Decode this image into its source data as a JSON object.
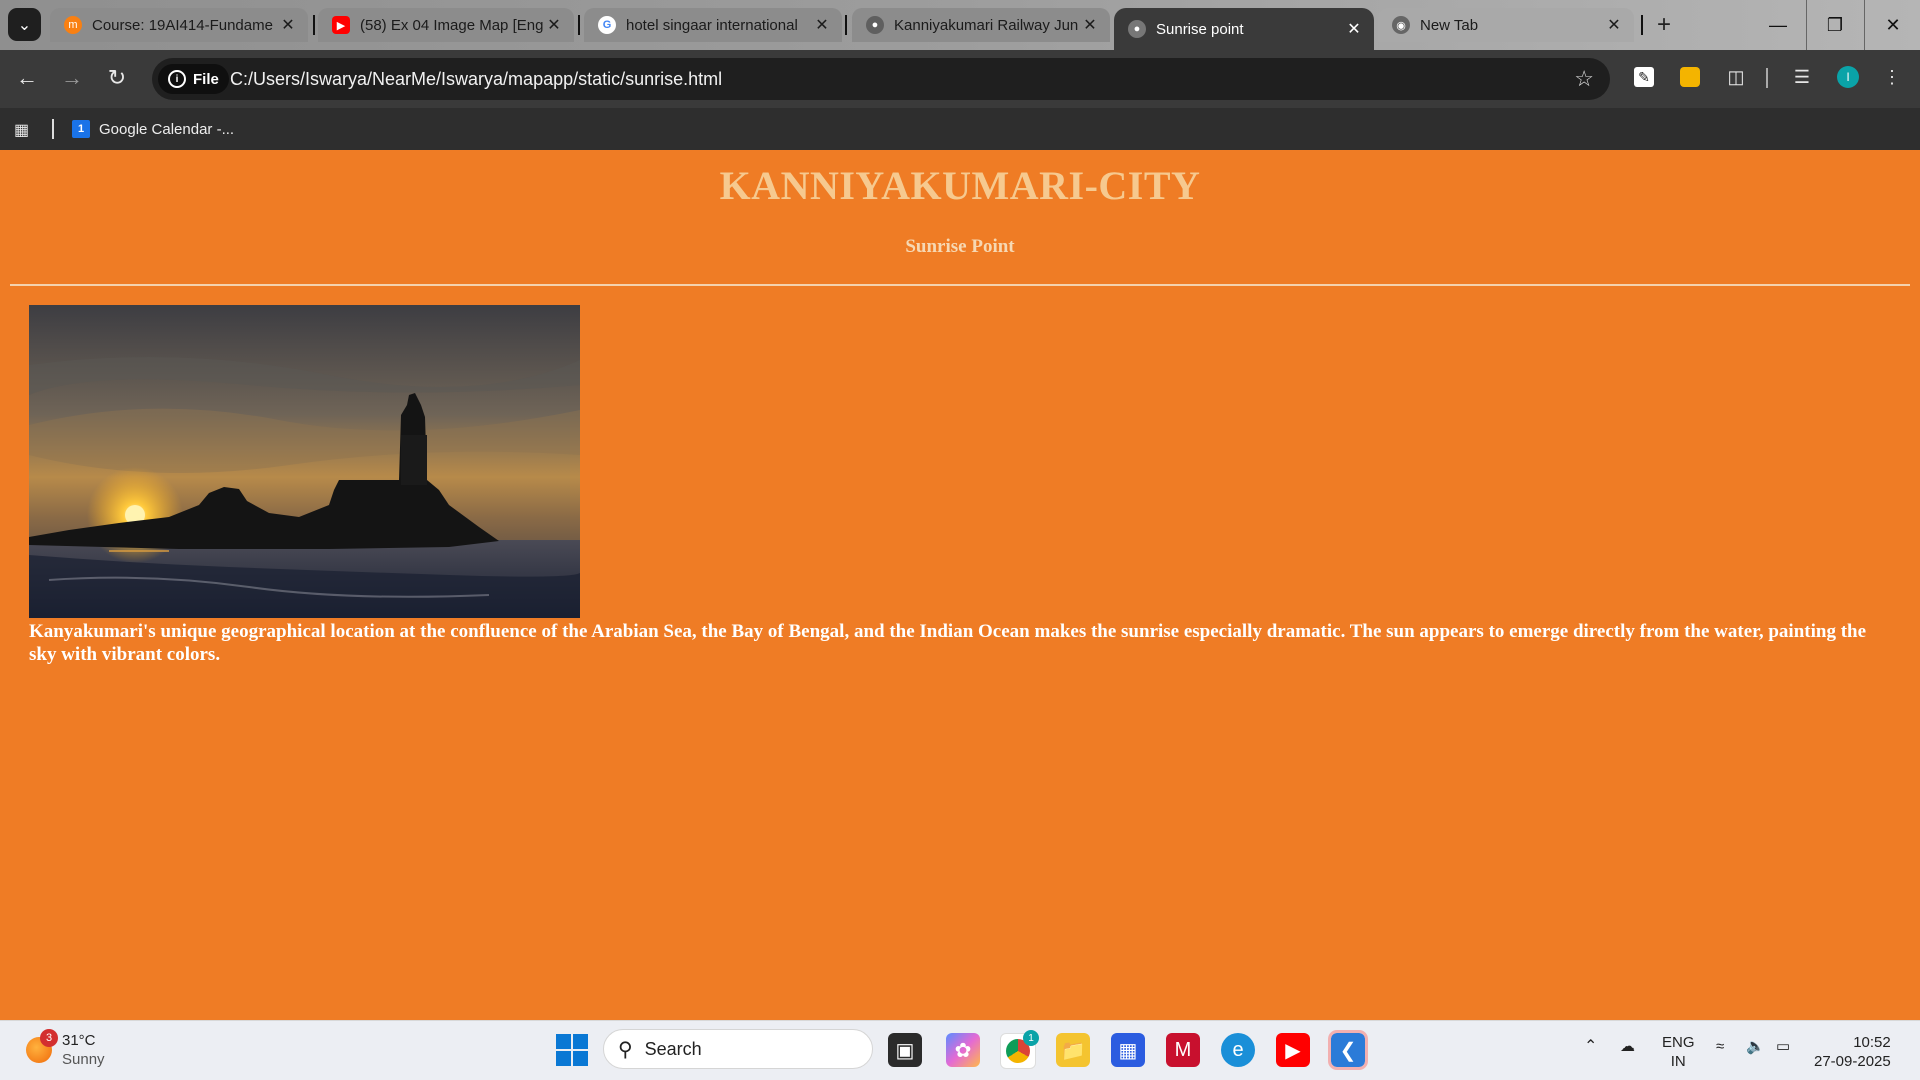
{
  "browser": {
    "tabs": [
      {
        "title": "Course: 19AI414-Fundame",
        "favicon": "moodle-icon",
        "color": "#f98012"
      },
      {
        "title": "(58) Ex 04 Image Map [Eng",
        "favicon": "youtube-icon",
        "color": "#ff0000"
      },
      {
        "title": "hotel singaar international",
        "favicon": "google-icon",
        "color": "#4285f4"
      },
      {
        "title": "Kanniyakumari Railway Jun",
        "favicon": "globe-icon",
        "color": "#555555"
      },
      {
        "title": "Sunrise point",
        "favicon": "globe-icon",
        "color": "#888888",
        "active": true
      },
      {
        "title": "New Tab",
        "favicon": "chrome-icon",
        "color": "#555555"
      }
    ],
    "address": {
      "scheme_label": "File",
      "url": "C:/Users/Iswarya/NearMe/Iswarya/mapapp/static/sunrise.html"
    },
    "profile_initial": "I",
    "bookmarks": [
      {
        "label": "Google Calendar -...",
        "icon_text": "1"
      }
    ]
  },
  "page": {
    "title": "KANNIYAKUMARI-CITY",
    "subtitle": "Sunrise Point",
    "image_alt": "sunrise-photo",
    "description": "Kanyakumari's unique geographical location at the confluence of the Arabian Sea, the Bay of Bengal, and the Indian Ocean makes the sunrise especially dramatic. The sun appears to emerge directly from the water, painting the sky with vibrant colors.",
    "background_color": "#ef7c25"
  },
  "taskbar": {
    "weather": {
      "temp": "31°C",
      "condition": "Sunny",
      "badge": "3"
    },
    "search_label": "Search",
    "chrome_badge": "1",
    "lang": {
      "line1": "ENG",
      "line2": "IN"
    },
    "clock": {
      "time": "10:52",
      "date": "27-09-2025"
    }
  }
}
